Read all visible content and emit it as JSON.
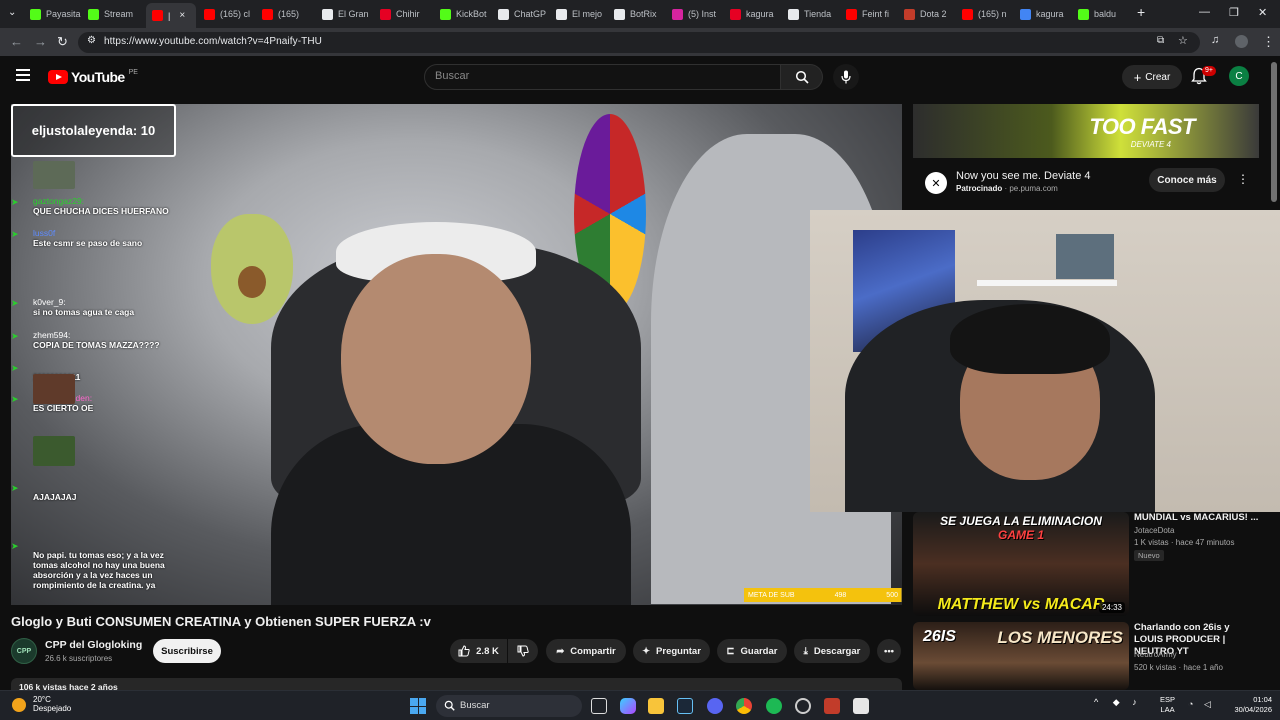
{
  "browser": {
    "tabs": [
      {
        "label": "Payasita",
        "color": "#53fc18",
        "active": false
      },
      {
        "label": "Stream",
        "color": "#53fc18",
        "active": false
      },
      {
        "label": "|",
        "color": "#ff0000",
        "active": true
      },
      {
        "label": "(165) cl",
        "color": "#ff0000",
        "active": false
      },
      {
        "label": "(165)",
        "color": "#ff0000",
        "active": false
      },
      {
        "label": "El Gran",
        "color": "#e8eaed",
        "active": false
      },
      {
        "label": "Chihir",
        "color": "#e60023",
        "active": false
      },
      {
        "label": "KickBot",
        "color": "#53fc18",
        "active": false
      },
      {
        "label": "ChatGP",
        "color": "#e8eaed",
        "active": false
      },
      {
        "label": "El mejo",
        "color": "#e8eaed",
        "active": false
      },
      {
        "label": "BotRix",
        "color": "#e8eaed",
        "active": false
      },
      {
        "label": "(5) Inst",
        "color": "#d6249f",
        "active": false
      },
      {
        "label": "kagura",
        "color": "#e60023",
        "active": false
      },
      {
        "label": "Tienda",
        "color": "#e8eaed",
        "active": false
      },
      {
        "label": "Feint fi",
        "color": "#ff0000",
        "active": false
      },
      {
        "label": "Dota 2",
        "color": "#c23c2a",
        "active": false
      },
      {
        "label": "(165) n",
        "color": "#ff0000",
        "active": false
      },
      {
        "label": "kagura",
        "color": "#4285f4",
        "active": false
      },
      {
        "label": "baldu",
        "color": "#53fc18",
        "active": false
      }
    ],
    "new_tab": "+",
    "url": "https://www.youtube.com/watch?v=4Pnaify-THU"
  },
  "youtube": {
    "logo_text": "YouTube",
    "country": "PE",
    "search_placeholder": "Buscar",
    "create_label": "Crear",
    "notifications_badge": "9+",
    "avatar_letter": "C"
  },
  "stream_overlay": {
    "counter": "eljustolaleyenda: 10",
    "sub_goal_label": "META DE SUB",
    "sub_goal_current": "498",
    "sub_goal_target": "500",
    "sub_goal_progress": 0.996,
    "chat": [
      {
        "user": "gaztongaz29:",
        "text": "QUE CHUCHA DICES HUERFANO",
        "user_color": "#29d02c"
      },
      {
        "user": "luss0f",
        "text": "Este csmr se paso de sano",
        "user_color": "#5e8bff"
      },
      {
        "user": "k0ver_9:",
        "text": "si no tomas agua te caga",
        "user_color": "#ffffff"
      },
      {
        "user": "zhem594:",
        "text": "COPIA DE TOMAS MAZZA????",
        "user_color": "#ffffff"
      },
      {
        "user": "",
        "text": "11111111111",
        "user_color": "#ff66cc"
      },
      {
        "user": "ElBotdeReiden:",
        "text": "ES CIERTO OE",
        "user_color": "#ff66cc"
      },
      {
        "user": "",
        "text": "AJAJAJAJ",
        "user_color": "#5e8bff"
      },
      {
        "user": "",
        "text": "No papi. tu tomas eso; y a la vez tomas alcohol no hay una buena absorción y a la vez haces un rompimiento de la creatina. ya",
        "user_color": "#5e8bff"
      }
    ]
  },
  "video": {
    "title": "Gloglo y Buti CONSUMEN CREATINA y Obtienen SUPER FUERZA :v",
    "channel": "CPP del Glogloking",
    "channel_avatar_text": "CPP",
    "subscribers": "26.6 k suscriptores",
    "subscribe_label": "Suscribirse",
    "likes": "2.8 K",
    "share_label": "Compartir",
    "ask_label": "Preguntar",
    "save_label": "Guardar",
    "download_label": "Descargar",
    "views": "106 k vistas  hace 2 años"
  },
  "ad": {
    "headline": "TOO FAST",
    "subheadline": "DEVIATE 4",
    "title": "Now you see me. Deviate 4",
    "sponsored": "Patrocinado",
    "domain": "pe.puma.com",
    "cta": "Conoce más"
  },
  "recommendations": [
    {
      "title": "MUNDIAL vs MACARIUS! ...",
      "channel": "JotaceDota",
      "meta": "1 K vistas · hace 47 minutos",
      "badge": "Nuevo",
      "duration": "24:33",
      "thumb_caption_top": "SE JUEGA LA ELIMINACION",
      "thumb_caption_mid": "GAME 1",
      "thumb_caption_bottom": "MATTHEW vs MACAR"
    },
    {
      "title": "Charlando con 26is y LOUIS PRODUCER | NEUTRO YT",
      "channel": "NeutroArmy",
      "meta": "520 k vistas · hace 1 año",
      "thumb_caption_top": "26IS",
      "thumb_caption_mid": "LOS MENORES"
    }
  ],
  "taskbar": {
    "temp": "20°C",
    "weather": "Despejado",
    "search_label": "Buscar",
    "lang_top": "ESP",
    "lang_bottom": "LAA",
    "time": "01:04",
    "date": "30/04/2026"
  },
  "colors": {
    "yt_red": "#ff0000",
    "kick_green": "#53fc18",
    "goal_yellow": "#f4c20d"
  }
}
